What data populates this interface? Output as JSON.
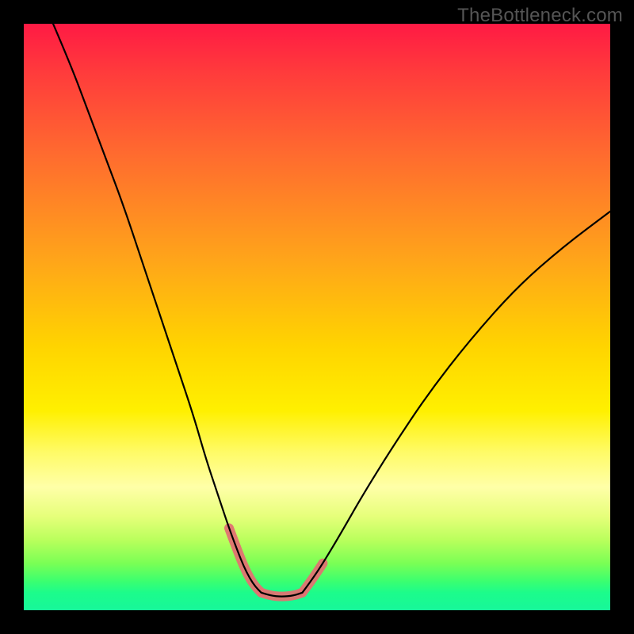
{
  "watermark": "TheBottleneck.com",
  "colors": {
    "page_bg": "#000000",
    "curve_stroke": "#000000",
    "highlight_stroke": "#e17272",
    "gradient_top": "#ff1a44",
    "gradient_mid": "#fff000",
    "gradient_bottom": "#17f79a"
  },
  "chart_data": {
    "type": "line",
    "title": "",
    "xlabel": "",
    "ylabel": "",
    "xlim": [
      0,
      100
    ],
    "ylim": [
      0,
      100
    ],
    "grid": false,
    "legend": false,
    "series": [
      {
        "name": "left-curve",
        "x": [
          5,
          8,
          11,
          14,
          17,
          20,
          23,
          26,
          29,
          31,
          33,
          35,
          36.5,
          37.5,
          38.5,
          39.5,
          40.5
        ],
        "y": [
          100,
          93,
          85,
          77,
          69,
          60,
          51,
          42,
          33,
          26,
          20,
          14,
          10,
          7.5,
          5.5,
          4,
          3
        ]
      },
      {
        "name": "trough",
        "x": [
          40.5,
          42,
          44,
          46,
          47.5
        ],
        "y": [
          3,
          2.5,
          2.3,
          2.5,
          3
        ]
      },
      {
        "name": "right-curve",
        "x": [
          47.5,
          49,
          51,
          54,
          58,
          63,
          69,
          76,
          84,
          92,
          100
        ],
        "y": [
          3,
          5,
          8,
          13,
          20,
          28,
          37,
          46,
          55,
          62,
          68
        ]
      }
    ],
    "annotations": [
      {
        "name": "highlight-left-descend",
        "on_series": "left-curve",
        "x_range": [
          35,
          40.5
        ]
      },
      {
        "name": "highlight-right-ascend",
        "on_series": "right-curve",
        "x_range": [
          47.5,
          51
        ]
      },
      {
        "name": "highlight-trough",
        "on_series": "trough",
        "x_range": [
          40.5,
          47.5
        ]
      }
    ],
    "background": {
      "type": "vertical-gradient",
      "meaning": "color scale from red (high/bad) at top to green (low/good) at bottom"
    }
  }
}
